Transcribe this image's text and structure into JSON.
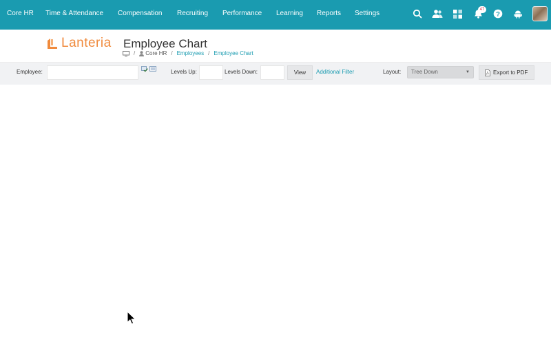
{
  "nav": {
    "items": [
      "Core HR",
      "Time & Attendance",
      "Compensation",
      "Recruiting",
      "Performance",
      "Learning",
      "Reports",
      "Settings"
    ],
    "notification_count": "47",
    "icons": [
      "search-icon",
      "people-icon",
      "apps-grid-icon",
      "bell-icon",
      "help-icon",
      "android-icon"
    ]
  },
  "header": {
    "logo": "Lanteria",
    "title": "Employee Chart",
    "breadcrumb": {
      "home_sep": "/",
      "core": "Core HR",
      "sep1": "/",
      "employees": "Employees",
      "sep2": "/",
      "current": "Employee Chart"
    }
  },
  "toolbar": {
    "employee_label": "Employee:",
    "employee_value": "",
    "levels_up_label": "Levels Up:",
    "levels_up_value": "",
    "levels_down_label": "Levels Down:",
    "levels_down_value": "",
    "view_label": "View",
    "filter_label": "Additional Filter",
    "layout_label": "Layout:",
    "layout_value": "Tree Down",
    "export_label": "Export to PDF"
  },
  "colors": {
    "nav_bg": "#1a9bb0",
    "brand_orange": "#f08a3c",
    "link": "#1a9bb0"
  }
}
